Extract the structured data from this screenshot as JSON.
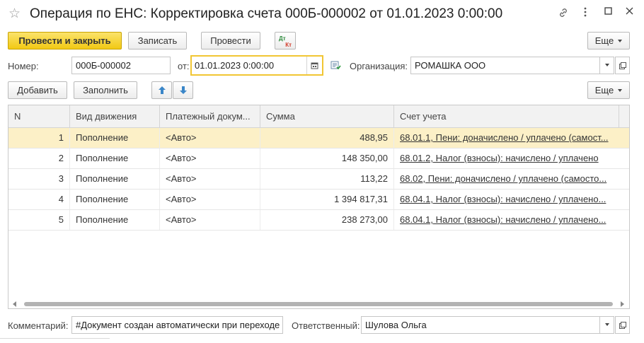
{
  "window": {
    "title": "Операция по ЕНС: Корректировка счета 000Б-000002 от 01.01.2023 0:00:00"
  },
  "toolbar": {
    "post_close": "Провести и закрыть",
    "save": "Записать",
    "post": "Провести",
    "dt_kt_top": "Дт",
    "dt_kt_bottom": "Кт",
    "more": "Еще"
  },
  "header": {
    "number_label": "Номер:",
    "number_value": "000Б-000002",
    "date_label": "от:",
    "date_value": "01.01.2023  0:00:00",
    "org_label": "Организация:",
    "org_value": "РОМАШКА ООО"
  },
  "table_toolbar": {
    "add": "Добавить",
    "fill": "Заполнить",
    "more": "Еще"
  },
  "table": {
    "columns": [
      "N",
      "Вид движения",
      "Платежный докум...",
      "Сумма",
      "Счет учета"
    ],
    "rows": [
      {
        "n": "1",
        "movement": "Пополнение",
        "payment_doc": "<Авто>",
        "amount": "488,95",
        "account": "68.01.1, Пени: доначислено / уплачено (самост..."
      },
      {
        "n": "2",
        "movement": "Пополнение",
        "payment_doc": "<Авто>",
        "amount": "148 350,00",
        "account": "68.01.2, Налог (взносы): начислено / уплачено"
      },
      {
        "n": "3",
        "movement": "Пополнение",
        "payment_doc": "<Авто>",
        "amount": "113,22",
        "account": "68.02, Пени: доначислено / уплачено (самосто..."
      },
      {
        "n": "4",
        "movement": "Пополнение",
        "payment_doc": "<Авто>",
        "amount": "1 394 817,31",
        "account": "68.04.1, Налог (взносы): начислено / уплачено..."
      },
      {
        "n": "5",
        "movement": "Пополнение",
        "payment_doc": "<Авто>",
        "amount": "238 273,00",
        "account": "68.04.1, Налог (взносы): начислено / уплачено..."
      }
    ]
  },
  "footer": {
    "comment_label": "Комментарий:",
    "comment_value": "#Документ создан автоматически при переходе на ЕНС",
    "responsible_label": "Ответственный:",
    "responsible_value": "Шулова Ольга"
  },
  "colors": {
    "primary_button": "#f2c914",
    "selected_row": "#fcf0c7",
    "focus_border": "#f1c633"
  },
  "icons": {
    "favorite": "star-outline-icon",
    "link": "link-icon",
    "menu": "vertical-dots-icon",
    "maximize": "maximize-icon",
    "close": "close-icon",
    "calendar": "calendar-icon",
    "move_up": "arrow-up-icon",
    "move_down": "arrow-down-icon",
    "open": "open-form-icon",
    "list_post": "document-post-icon"
  }
}
